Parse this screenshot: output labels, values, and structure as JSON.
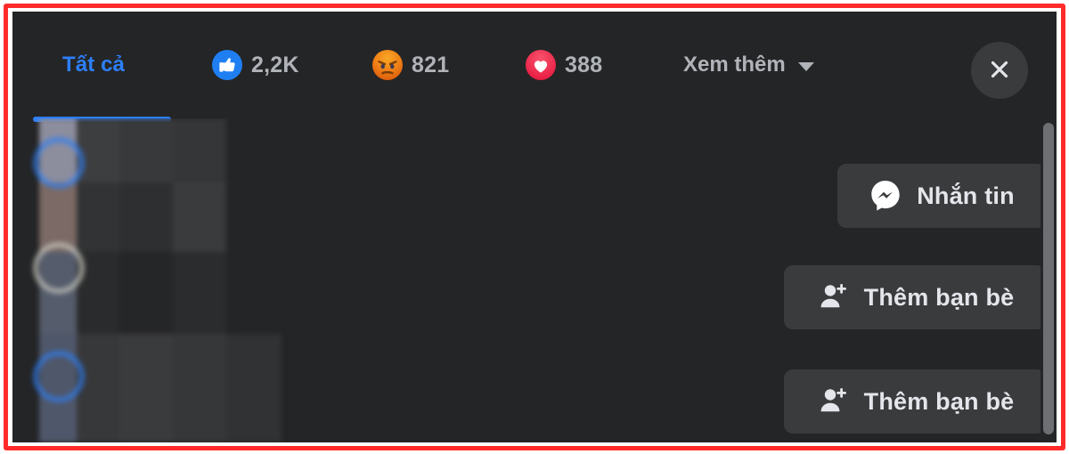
{
  "frame": {
    "accent_color": "#ff2b2b"
  },
  "dialog": {
    "background": "#242526",
    "surface": "#3a3b3c",
    "text_primary": "#e4e6eb",
    "text_secondary": "#b0b3b8",
    "accent_blue": "#2d7ff9"
  },
  "header": {
    "tabs": [
      {
        "id": "all",
        "label": "Tất cả",
        "count": "",
        "icon": "",
        "active": true
      },
      {
        "id": "like",
        "label": "",
        "count": "2,2K",
        "icon": "like-reaction-icon",
        "active": false
      },
      {
        "id": "angry",
        "label": "",
        "count": "821",
        "icon": "angry-reaction-icon",
        "active": false
      },
      {
        "id": "love",
        "label": "",
        "count": "388",
        "icon": "love-reaction-icon",
        "active": false
      }
    ],
    "see_more": {
      "label": "Xem thêm",
      "icon": "chevron-down-icon"
    },
    "close": {
      "icon": "close-icon",
      "label": "×"
    }
  },
  "reaction_colors": {
    "like": "#1f7ff2",
    "angry_outer": "#e0700b",
    "angry_inner": "#f7a928",
    "love_outer": "#f3425f",
    "love_inner": "#e8234a"
  },
  "rows": [
    {
      "name_redacted": true,
      "avatar_ring": "#2d7ff9",
      "action": {
        "id": "message",
        "label": "Nhắn tin",
        "icon": "messenger-icon"
      }
    },
    {
      "name_redacted": true,
      "avatar_ring": "#cfcfc6",
      "action": {
        "id": "add-friend",
        "label": "Thêm bạn bè",
        "icon": "add-friend-icon"
      }
    },
    {
      "name_redacted": true,
      "avatar_ring": "#2d7ff9",
      "action": {
        "id": "add-friend",
        "label": "Thêm bạn bè",
        "icon": "add-friend-icon"
      }
    }
  ],
  "scrollbar": {
    "orientation": "vertical",
    "thumb_color": "#6d6f72"
  }
}
